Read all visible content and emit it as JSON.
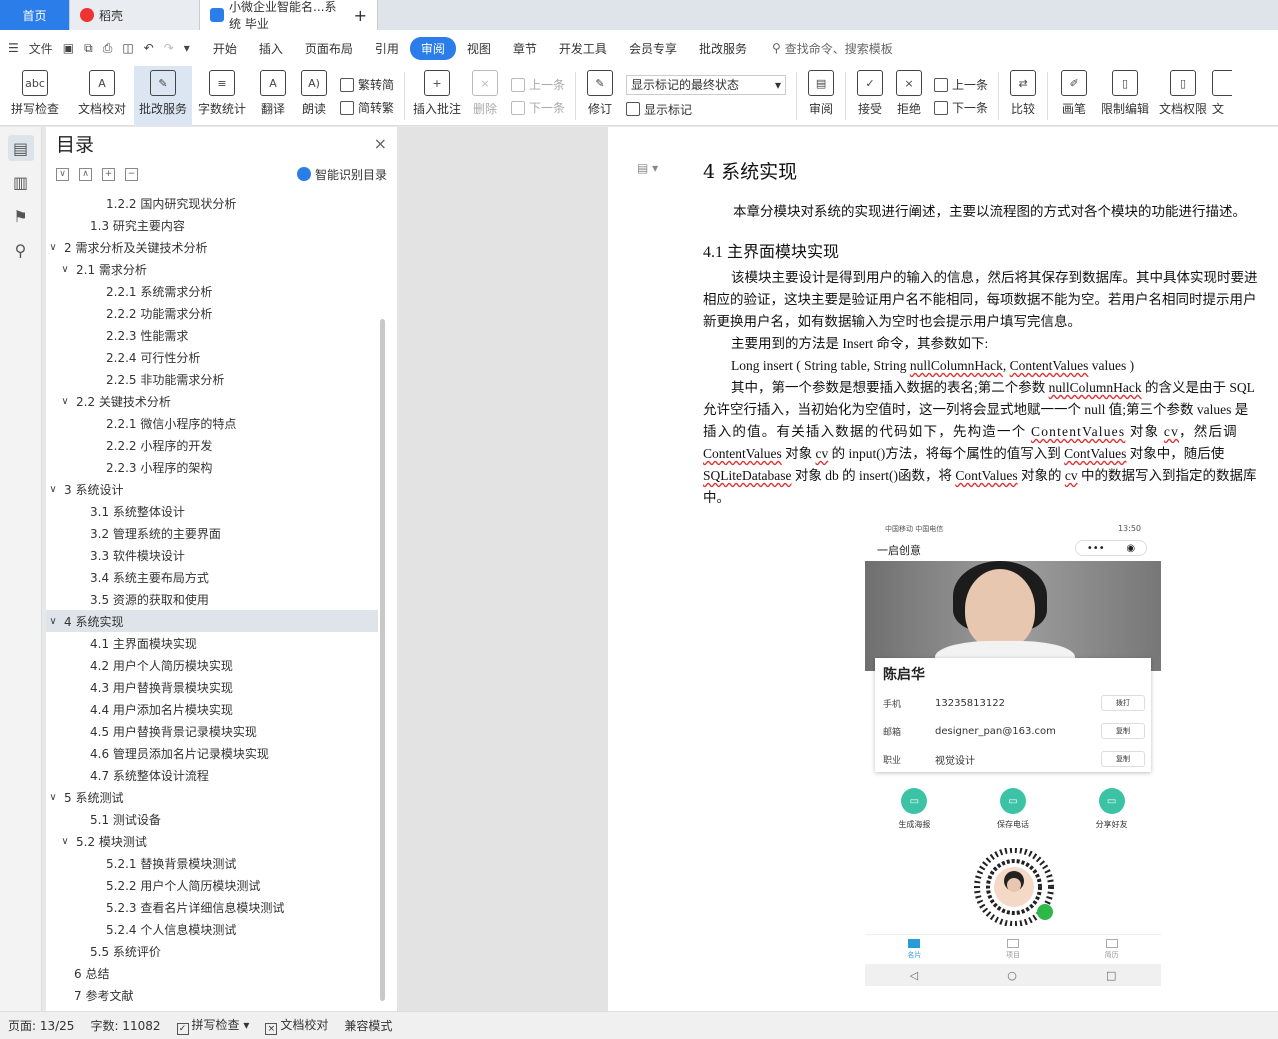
{
  "tabs": {
    "home": "首页",
    "daoke": "稻壳",
    "doc": "小微企业智能名...系统 毕业"
  },
  "menubar": {
    "file_label": "文件",
    "items": [
      "开始",
      "插入",
      "页面布局",
      "引用",
      "审阅",
      "视图",
      "章节",
      "开发工具",
      "会员专享",
      "批改服务"
    ],
    "active_index": 4,
    "search_placeholder": "查找命令、搜索模板"
  },
  "ribbon": {
    "spellcheck": "拼写检查",
    "doc_proof": "文档校对",
    "review_service": "批改服务",
    "word_count": "字数统计",
    "translate": "翻译",
    "read_aloud": "朗读",
    "trad_to_simp": "繁转简",
    "simp_to_trad": "简转繁",
    "insert_comment": "插入批注",
    "delete": "删除",
    "prev_comment": "上一条",
    "next_comment": "下一条",
    "revise": "修订",
    "markup_state": "显示标记的最终状态",
    "show_markup": "显示标记",
    "review_pane": "审阅",
    "accept": "接受",
    "reject": "拒绝",
    "prev_change": "上一条",
    "next_change": "下一条",
    "compare": "比较",
    "pen": "画笔",
    "restrict_edit": "限制编辑",
    "doc_permission": "文档权限",
    "cut_label": "文"
  },
  "toc": {
    "title": "目录",
    "smart_label": "智能识别目录",
    "items": [
      {
        "text": "1.2.2 国内研究现状分析",
        "level": 3,
        "toggle": ""
      },
      {
        "text": "1.3  研究主要内容",
        "level": 2,
        "toggle": ""
      },
      {
        "text": "2  需求分析及关键技术分析",
        "level": 1,
        "toggle": "∨"
      },
      {
        "text": "2.1 需求分析",
        "level": 2,
        "toggle": "∨"
      },
      {
        "text": "2.2.1 系统需求分析",
        "level": 3,
        "toggle": ""
      },
      {
        "text": "2.2.2 功能需求分析",
        "level": 3,
        "toggle": ""
      },
      {
        "text": "2.2.3 性能需求",
        "level": 3,
        "toggle": ""
      },
      {
        "text": "2.2.4 可行性分析",
        "level": 3,
        "toggle": ""
      },
      {
        "text": "2.2.5 非功能需求分析",
        "level": 3,
        "toggle": ""
      },
      {
        "text": "2.2 关键技术分析",
        "level": 2,
        "toggle": "∨"
      },
      {
        "text": "2.2.1 微信小程序的特点",
        "level": 3,
        "toggle": ""
      },
      {
        "text": "2.2.2 小程序的开发",
        "level": 3,
        "toggle": ""
      },
      {
        "text": "2.2.3 小程序的架构",
        "level": 3,
        "toggle": ""
      },
      {
        "text": "3  系统设计",
        "level": 1,
        "toggle": "∨"
      },
      {
        "text": "3.1  系统整体设计",
        "level": 2,
        "toggle": ""
      },
      {
        "text": "3.2 管理系统的主要界面",
        "level": 2,
        "toggle": ""
      },
      {
        "text": "3.3 软件模块设计",
        "level": 2,
        "toggle": ""
      },
      {
        "text": "3.4 系统主要布局方式",
        "level": 2,
        "toggle": ""
      },
      {
        "text": "3.5 资源的获取和使用",
        "level": 2,
        "toggle": ""
      },
      {
        "text": "4  系统实现",
        "level": 1,
        "toggle": "∨",
        "selected": true
      },
      {
        "text": "4.1 主界面模块实现",
        "level": 2,
        "toggle": ""
      },
      {
        "text": "4.2 用户个人简历模块实现",
        "level": 2,
        "toggle": ""
      },
      {
        "text": "4.3 用户替换背景模块实现",
        "level": 2,
        "toggle": ""
      },
      {
        "text": "4.4 用户添加名片模块实现",
        "level": 2,
        "toggle": ""
      },
      {
        "text": "4.5 用户替换背景记录模块实现",
        "level": 2,
        "toggle": ""
      },
      {
        "text": "4.6 管理员添加名片记录模块实现",
        "level": 2,
        "toggle": ""
      },
      {
        "text": "4.7 系统整体设计流程",
        "level": 2,
        "toggle": ""
      },
      {
        "text": "5  系统测试",
        "level": 1,
        "toggle": "∨"
      },
      {
        "text": "5.1  测试设备",
        "level": 2,
        "toggle": ""
      },
      {
        "text": "5.2  模块测试",
        "level": 2,
        "toggle": "∨"
      },
      {
        "text": "5.2.1 替换背景模块测试",
        "level": 3,
        "toggle": ""
      },
      {
        "text": "5.2.2 用户个人简历模块测试",
        "level": 3,
        "toggle": ""
      },
      {
        "text": "5.2.3 查看名片详细信息模块测试",
        "level": 3,
        "toggle": ""
      },
      {
        "text": "5.2.4 个人信息模块测试",
        "level": 3,
        "toggle": ""
      },
      {
        "text": "5.5 系统评价",
        "level": 2,
        "toggle": ""
      },
      {
        "text": "6 总结",
        "level": 1,
        "toggle": ""
      },
      {
        "text": "7 参考文献",
        "level": 1,
        "toggle": ""
      }
    ]
  },
  "document": {
    "heading": "4  系统实现",
    "intro": "本章分模块对系统的实现进行阐述，主要以流程图的方式对各个模块的功能进行描述。",
    "subheading": "4.1 主界面模块实现",
    "p1_l1": "该模块主要设计是得到用户的输入的信息，然后将其保存到数据库。其中具体实现时要进",
    "p1_l2": "相应的验证，这块主要是验证用户名不能相同，每项数据不能为空。若用户名相同时提示用户",
    "p1_l3": "新更换用户名，如有数据输入为空时也会提示用户填写完信息。",
    "p2": "主要用到的方法是 Insert 命令，其参数如下:",
    "code_a": "Long insert ( String table, String ",
    "code_b": "nullColumnHack",
    "code_c": ", ",
    "code_d": "ContentValues",
    "code_e": " values )",
    "p3_l1a": "其中，第一个参数是想要插入数据的表名;第二个参数 ",
    "p3_l1b": "nullColumnHack",
    "p3_l1c": " 的含义是由于 SQL",
    "p3_l2": "允许空行插入，当初始化为空值时，这一列将会显式地赋一一个 null 值;第三个参数 values 是",
    "p3_l3a": "插入的值。有关插入数据的代码如下，先构造一个 ",
    "p3_l3b": "ContentValues",
    "p3_l3c": " 对象 ",
    "p3_l3d": "cv",
    "p3_l3e": "，然后调",
    "p3_l4a": "ContentValues",
    "p3_l4b": " 对象 ",
    "p3_l4c": "cv",
    "p3_l4d": " 的 input()方法，将每个属性的值写入到 ",
    "p3_l4e": "ContValues",
    "p3_l4f": " 对象中，随后使",
    "p3_l5a": "SQLiteDatabase",
    "p3_l5b": " 对象 db 的 insert()函数，将 ",
    "p3_l5c": "ContValues",
    "p3_l5d": " 对象的 ",
    "p3_l5e": "cv",
    "p3_l5f": " 中的数据写入到指定的数据库",
    "p3_l6": "中。"
  },
  "phone": {
    "carrier": "中国移动 中国电信",
    "time": "13:50",
    "app_name": "一启创意",
    "caps_dots": "•••",
    "caps_circle": "◉",
    "name": "陈启华",
    "rows": [
      {
        "k": "手机",
        "v": "13235813122",
        "b": "拨打"
      },
      {
        "k": "邮箱",
        "v": "designer_pan@163.com",
        "b": "复制"
      },
      {
        "k": "职业",
        "v": "视觉设计",
        "b": "复制"
      }
    ],
    "actions": [
      "生成海报",
      "保存电话",
      "分享好友"
    ],
    "tabs": [
      "名片",
      "项目",
      "简历"
    ]
  },
  "statusbar": {
    "page": "页面: 13/25",
    "words": "字数: 11082",
    "spell": "拼写检查",
    "proof": "文档校对",
    "mode": "兼容模式"
  }
}
